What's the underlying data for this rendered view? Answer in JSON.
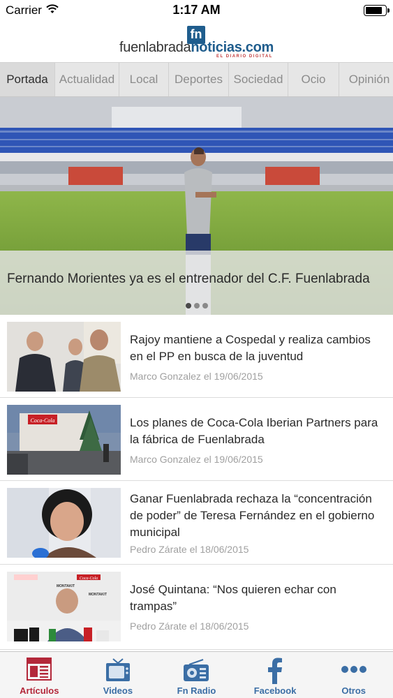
{
  "status_bar": {
    "carrier": "Carrier",
    "time": "1:17 AM",
    "battery_level": 0.9
  },
  "header": {
    "logo_mark": "fn",
    "logo_part1": "fuenlabrada",
    "logo_part2": "noticias.com",
    "logo_tagline": "EL DIARIO DIGITAL"
  },
  "tabs": [
    {
      "label": "Portada",
      "active": true
    },
    {
      "label": "Actualidad"
    },
    {
      "label": "Local"
    },
    {
      "label": "Deportes"
    },
    {
      "label": "Sociedad"
    },
    {
      "label": "Ocio"
    },
    {
      "label": "Opinión"
    }
  ],
  "hero": {
    "caption": "Fernando Morientes ya es el entrenador del C.F. Fuenlabrada",
    "pages": 3,
    "current_page": 1
  },
  "articles": [
    {
      "title": "Rajoy mantiene a Cospedal y realiza cambios en el PP en busca de la juventud",
      "meta": "Marco Gonzalez el 19/06/2015",
      "thumb": "politicians-photo"
    },
    {
      "title": "Los planes de Coca-Cola Iberian Partners para la fábrica de Fuenlabrada",
      "meta": "Marco Gonzalez el 19/06/2015",
      "thumb": "factory-photo"
    },
    {
      "title": "Ganar Fuenlabrada rechaza la “concentración de poder” de Teresa Fernández en el gobierno municipal",
      "meta": "Pedro Zárate el 18/06/2015",
      "thumb": "woman-photo"
    },
    {
      "title": "José Quintana: “Nos quieren echar con trampas”",
      "meta": "Pedro Zárate el 18/06/2015",
      "thumb": "press-conference-photo"
    }
  ],
  "thumb_text": {
    "cocacola": "Coca-Cola",
    "montakit": "MONTAKIT"
  },
  "tab_bar": [
    {
      "label": "Artículos",
      "icon": "newspaper-icon",
      "active": true
    },
    {
      "label": "Videos",
      "icon": "tv-icon"
    },
    {
      "label": "Fn Radio",
      "icon": "radio-icon"
    },
    {
      "label": "Facebook",
      "icon": "facebook-icon"
    },
    {
      "label": "Otros",
      "icon": "more-icon"
    }
  ],
  "colors": {
    "brand_blue": "#1f5d8d",
    "active_red": "#b3283a",
    "tab_blue": "#3b6ea5"
  }
}
